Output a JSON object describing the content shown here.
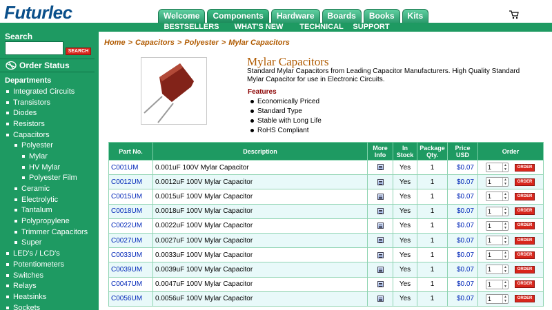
{
  "header": {
    "logo_text": "Futurlec",
    "tabs": [
      "Welcome",
      "Components",
      "Hardware",
      "Boards",
      "Books",
      "Kits"
    ],
    "active_tab": "Components",
    "subnav": [
      "BESTSELLERS",
      "WHAT'S NEW",
      "TECHNICAL",
      "SUPPORT"
    ],
    "cart_icon": "cart-icon"
  },
  "sidebar": {
    "search_label": "Search",
    "search_button": "SEARCH",
    "order_status": "Order Status",
    "departments_title": "Departments",
    "items": [
      {
        "label": "Integrated Circuits",
        "level": 0
      },
      {
        "label": "Transistors",
        "level": 0
      },
      {
        "label": "Diodes",
        "level": 0
      },
      {
        "label": "Resistors",
        "level": 0
      },
      {
        "label": "Capacitors",
        "level": 0
      },
      {
        "label": "Polyester",
        "level": 1
      },
      {
        "label": "Mylar",
        "level": 2
      },
      {
        "label": "HV Mylar",
        "level": 2
      },
      {
        "label": "Polyester Film",
        "level": 2
      },
      {
        "label": "Ceramic",
        "level": 1
      },
      {
        "label": "Electrolytic",
        "level": 1
      },
      {
        "label": "Tantalum",
        "level": 1
      },
      {
        "label": "Polypropylene",
        "level": 1
      },
      {
        "label": "Trimmer Capacitors",
        "level": 1
      },
      {
        "label": "Super",
        "level": 1
      },
      {
        "label": "LED's / LCD's",
        "level": 0
      },
      {
        "label": "Potentiometers",
        "level": 0
      },
      {
        "label": "Switches",
        "level": 0
      },
      {
        "label": "Relays",
        "level": 0
      },
      {
        "label": "Heatsinks",
        "level": 0
      },
      {
        "label": "Sockets",
        "level": 0
      }
    ]
  },
  "breadcrumb": [
    "Home",
    "Capacitors",
    "Polyester",
    "Mylar Capacitors"
  ],
  "breadcrumb_sep": ">",
  "product": {
    "title": "Mylar Capacitors",
    "description": "Standard Mylar Capacitors from Leading Capacitor Manufacturers. High Quality Standard Mylar Capacitor for use in Electronic Circuits.",
    "features_title": "Features",
    "features": [
      "Economically Priced",
      "Standard Type",
      "Stable with Long Life",
      "RoHS Compliant"
    ]
  },
  "table": {
    "headers": [
      "Part No.",
      "Description",
      "More Info",
      "In Stock",
      "Package Qty.",
      "Price USD",
      "Order"
    ],
    "order_button": "ORDER",
    "rows": [
      {
        "part": "C001UM",
        "desc": "0.001uF 100V Mylar Capacitor",
        "stock": "Yes",
        "pkg": "1",
        "price": "$0.07",
        "qty": "1"
      },
      {
        "part": "C0012UM",
        "desc": "0.0012uF 100V Mylar Capacitor",
        "stock": "Yes",
        "pkg": "1",
        "price": "$0.07",
        "qty": "1"
      },
      {
        "part": "C0015UM",
        "desc": "0.0015uF 100V Mylar Capacitor",
        "stock": "Yes",
        "pkg": "1",
        "price": "$0.07",
        "qty": "1"
      },
      {
        "part": "C0018UM",
        "desc": "0.0018uF 100V Mylar Capacitor",
        "stock": "Yes",
        "pkg": "1",
        "price": "$0.07",
        "qty": "1"
      },
      {
        "part": "C0022UM",
        "desc": "0.0022uF 100V Mylar Capacitor",
        "stock": "Yes",
        "pkg": "1",
        "price": "$0.07",
        "qty": "1"
      },
      {
        "part": "C0027UM",
        "desc": "0.0027uF 100V Mylar Capacitor",
        "stock": "Yes",
        "pkg": "1",
        "price": "$0.07",
        "qty": "1"
      },
      {
        "part": "C0033UM",
        "desc": "0.0033uF 100V Mylar Capacitor",
        "stock": "Yes",
        "pkg": "1",
        "price": "$0.07",
        "qty": "1"
      },
      {
        "part": "C0039UM",
        "desc": "0.0039uF 100V Mylar Capacitor",
        "stock": "Yes",
        "pkg": "1",
        "price": "$0.07",
        "qty": "1"
      },
      {
        "part": "C0047UM",
        "desc": "0.0047uF 100V Mylar Capacitor",
        "stock": "Yes",
        "pkg": "1",
        "price": "$0.07",
        "qty": "1"
      },
      {
        "part": "C0056UM",
        "desc": "0.0056uF 100V Mylar Capacitor",
        "stock": "Yes",
        "pkg": "1",
        "price": "$0.07",
        "qty": "1"
      }
    ]
  },
  "colors": {
    "brand_green": "#1e9a62",
    "logo_blue": "#0a4f8a",
    "title_orange": "#b05a00",
    "order_red": "#d8261c",
    "link_blue": "#0026b8"
  }
}
